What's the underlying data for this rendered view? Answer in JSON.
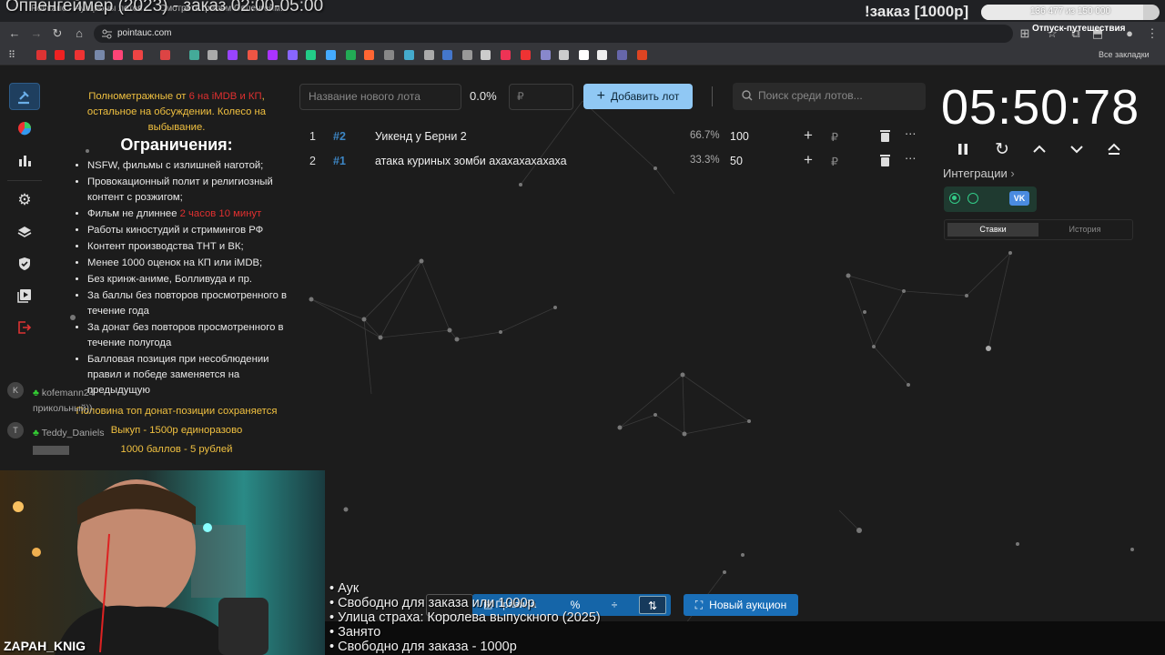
{
  "stream": {
    "title": "Оппенгеймер (2023) - заказ 02:00-05:00",
    "order_badge": "!заказ [1000р]",
    "progress_text": "136 477 из 150 000",
    "progress_fraction": 0.91
  },
  "browser": {
    "tab1": "Pointauc - Аукционы лотов",
    "tab2": "Смотреть фильм Оппенгейм...",
    "url": "pointauc.com",
    "vacation_label": "Отпуск-путешествия",
    "all_bookmarks": "Все закладки"
  },
  "rules": {
    "intro_1": "Полнометражные от ",
    "intro_red": "6 на iMDB и КП",
    "intro_2": ", остальное на обсуждении. Колесо на выбывание.",
    "heading": "Ограничения:",
    "items": [
      "NSFW, фильмы с излишней наготой;",
      "Провокационный полит и религиозный контент с розжигом;",
      "Фильм не длиннее ",
      "Работы киностудий и стримингов РФ",
      "Контент производства ТНТ и ВК;",
      "Менее 1000 оценок на КП или iMDB;",
      "Без кринж-аниме, Болливуда и пр.",
      "За баллы без повторов просмотренного в течение года",
      "За донат без повторов просмотренного в течение полугода",
      "Балловая позиция при несоблюдении правил и победе заменяется на предыдущую"
    ],
    "length_red": "2 часов 10 минут",
    "note_1": "Половина топ донат-позиции сохраняется",
    "note_2": "Выкуп - 1500р единоразово",
    "note_3": "1000 баллов - 5 рублей"
  },
  "chat": {
    "user1_initial": "K",
    "user1": "kofemann24",
    "user1_msg": "прикольный))",
    "user2_initial": "T",
    "user2": "Teddy_Daniels"
  },
  "toolbar": {
    "lot_name_placeholder": "Название нового лота",
    "percent": "0.0%",
    "currency": "₽",
    "add_label": "Добавить лот",
    "search_placeholder": "Поиск среди лотов..."
  },
  "lots": [
    {
      "idx": "1",
      "id": "#2",
      "name": "Уикенд у Берни 2",
      "pct": "66.7%",
      "amount": "100",
      "rub": "₽"
    },
    {
      "idx": "2",
      "id": "#1",
      "name": "атака куриных зомби ахахахахахаха",
      "pct": "33.3%",
      "amount": "50",
      "rub": "₽"
    }
  ],
  "timer": {
    "value": "05:50:78",
    "integrations_label": "Интеграции",
    "tab_bets": "Ставки",
    "tab_history": "История"
  },
  "bottom": {
    "rules_label": "Правила",
    "new_auction": "Новый аукцион",
    "playlist": [
      "• Аук",
      "• Свободно для заказа или  1000р",
      "• Улица страха: Королева выпускного (2025)",
      "• Занято",
      "• Свободно для заказа - 1000р"
    ],
    "cam_label": "ZAPAH_KNIG"
  },
  "colors": {
    "accent": "#90c8f4",
    "lot_id": "#3d86c4",
    "warning": "#f0c040",
    "danger": "#e03030"
  }
}
